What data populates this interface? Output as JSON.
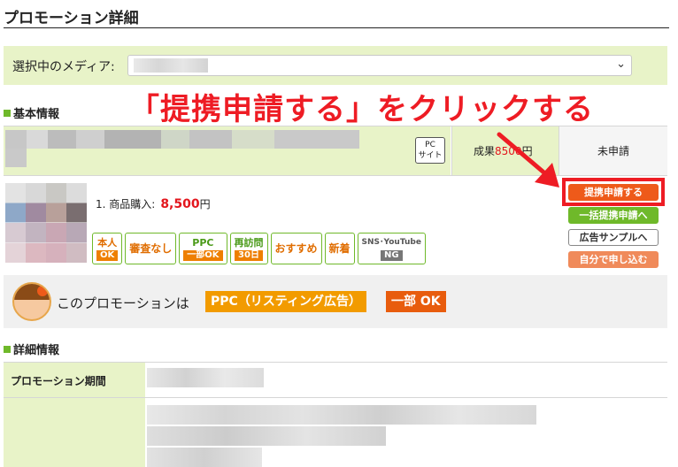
{
  "page": {
    "title": "プロモーション詳細"
  },
  "media_selector": {
    "label": "選択中のメディア:",
    "chevron_icon": "chevron-down-icon"
  },
  "sections": {
    "basic_info": "基本情報",
    "detail_info": "詳細情報"
  },
  "annotation": {
    "text": "「提携申請する」をクリックする",
    "color": "#ee1c24"
  },
  "promotion": {
    "pc_badge": [
      "PC",
      "サイト"
    ],
    "reward_prefix": "成果",
    "reward_amount": "8500",
    "reward_suffix": "円",
    "status": "未申請",
    "purchase_label": "1. 商品購入:",
    "purchase_price": "8,500",
    "purchase_unit": "円",
    "tags": [
      {
        "top": "本人",
        "bottom": "OK"
      },
      {
        "top": "審査なし",
        "bottom": ""
      },
      {
        "top": "PPC",
        "bottom": "一部OK"
      },
      {
        "top": "再訪問",
        "bottom": "30日"
      },
      {
        "top": "おすすめ",
        "bottom": ""
      },
      {
        "top": "新着",
        "bottom": ""
      },
      {
        "top": "SNS･YouTube",
        "bottom": "NG"
      }
    ]
  },
  "actions": {
    "apply": "提携申請する",
    "bulk_apply": "一括提携申請へ",
    "ad_sample": "広告サンプルへ",
    "self_apply": "自分で申し込む"
  },
  "ppc_notice": {
    "text": "このプロモーションは",
    "chip": "PPC（リスティング広告）",
    "chip_value": "一部 OK"
  },
  "details": {
    "period_label": "プロモーション期間"
  },
  "colors": {
    "accent_green": "#6fb92a",
    "panel_green": "#e8f3c8",
    "apply_orange": "#ee5a1a",
    "price_red": "#e3161d"
  }
}
